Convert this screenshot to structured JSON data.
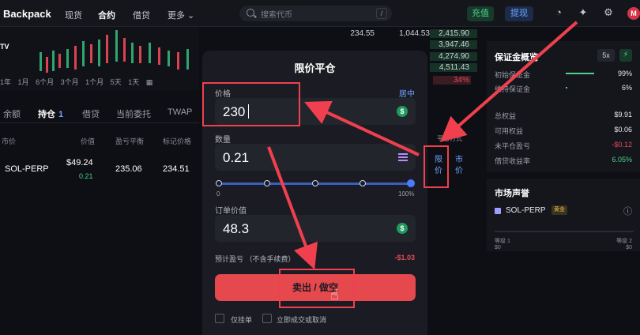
{
  "nav": {
    "brand": "Backpack",
    "items": [
      "现货",
      "合约",
      "借贷",
      "更多 ⌄"
    ],
    "active": "合约",
    "search_placeholder": "搜索代币",
    "search_key": "/",
    "deposit": "充值",
    "withdraw": "提现",
    "avatar": "M"
  },
  "chart": {
    "timeframes": [
      "1年",
      "1月",
      "6个月",
      "3个月",
      "1个月",
      "5天",
      "1天"
    ]
  },
  "orderbook": {
    "rows": [
      {
        "a": "234.55",
        "b": "1,044.53",
        "c": "2,415.90"
      },
      {
        "a": "",
        "b": "",
        "c": "3,947.46"
      },
      {
        "a": "",
        "b": "",
        "c": "4,274.90"
      },
      {
        "a": "",
        "b": "",
        "c": "4,511.43"
      }
    ],
    "pct": "34%"
  },
  "positions": {
    "tabs": [
      {
        "label": "余额",
        "badge": ""
      },
      {
        "label": "持仓",
        "badge": "1"
      },
      {
        "label": "借贷",
        "badge": ""
      },
      {
        "label": "当前委托",
        "badge": ""
      },
      {
        "label": "TWAP",
        "badge": ""
      }
    ],
    "columns": [
      "市价",
      "价值",
      "盈亏平衡",
      "标记价格"
    ],
    "row": {
      "symbol": "SOL-PERP",
      "value": "$49.24",
      "qty": "0.21",
      "breakeven": "235.06",
      "mark": "234.51"
    }
  },
  "modal": {
    "title": "限价平仓",
    "price_label": "价格",
    "price_mid": "居中",
    "price_value": "230",
    "qty_label": "数量",
    "qty_value": "0.21",
    "slider_min": "0",
    "slider_max": "100%",
    "slider_percent": 100,
    "order_value_label": "订单价值",
    "order_value": "48.3",
    "pnl_label": "预计盈亏 （不含手续费）",
    "pnl_value": "-$1.03",
    "sell_button": "卖出 / 做空",
    "post_only": "仅挂单",
    "ioc": "立即成交或取消"
  },
  "order_type": {
    "header": "平仓方式",
    "limit": "限价",
    "market": "市价"
  },
  "margin": {
    "title": "保证金概览",
    "leverage": "5x",
    "rows": [
      {
        "label": "初始保证金",
        "value": "99%",
        "tone": ""
      },
      {
        "label": "维持保证金",
        "value": "6%",
        "tone": ""
      },
      {
        "label": "总权益",
        "value": "$9.91",
        "tone": ""
      },
      {
        "label": "可用权益",
        "value": "$0.06",
        "tone": ""
      },
      {
        "label": "未平仓盈亏",
        "value": "-$0.12",
        "tone": "red"
      },
      {
        "label": "借贷收益率",
        "value": "6.05%",
        "tone": "green"
      }
    ]
  },
  "market": {
    "title": "市场声誉",
    "symbol": "SOL-PERP",
    "badge": "黄金",
    "level1": "等级 1",
    "level2": "等级 2",
    "min": "$0",
    "max": "$0"
  },
  "colors": {
    "accent": "#6ea2ff",
    "sell": "#e5484d",
    "annotation": "#f0404f",
    "green": "#4cd08a"
  }
}
